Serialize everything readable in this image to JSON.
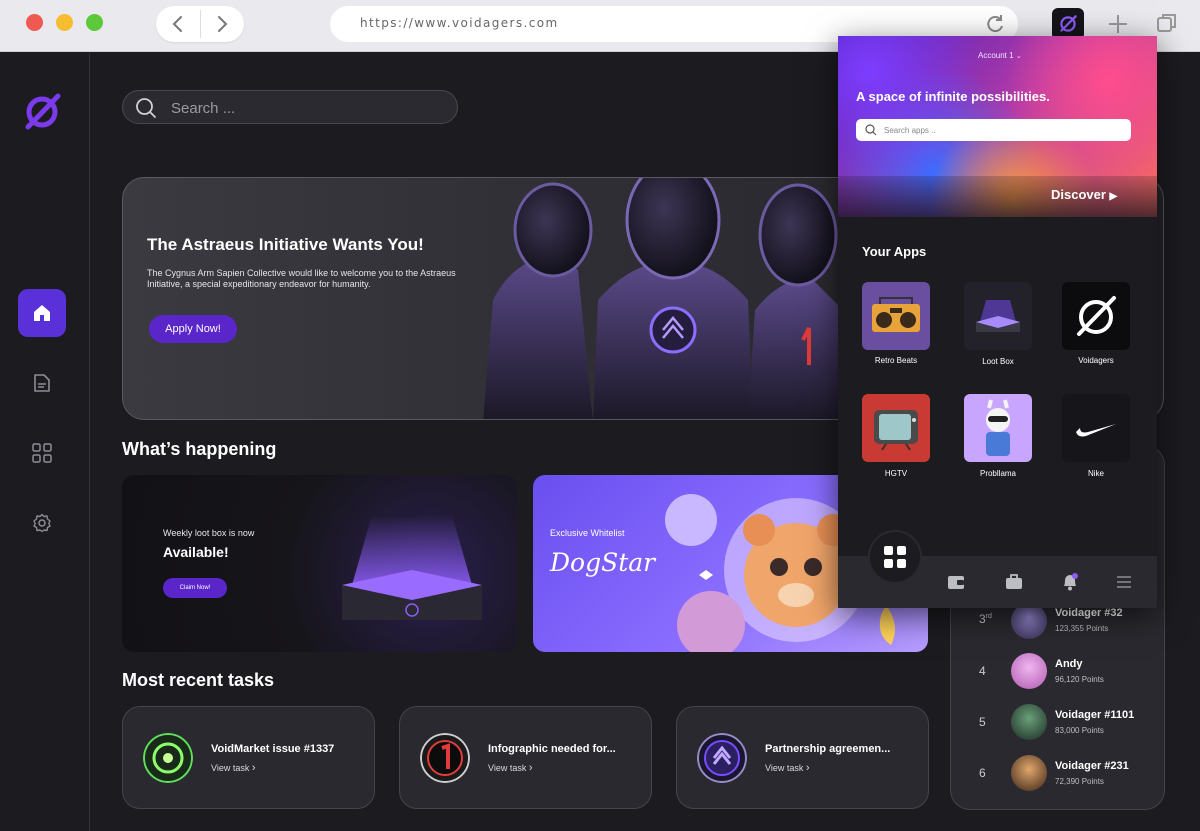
{
  "browser": {
    "url": "https://www.voidagers.com"
  },
  "search": {
    "placeholder": "Search ..."
  },
  "hero": {
    "title": "The Astraeus Initiative Wants You!",
    "description": "The Cygnus Arm Sapien Collective would like to welcome you to the Astraeus Initiative, a special expeditionary endeavor for humanity.",
    "cta": "Apply Now!"
  },
  "happening": {
    "heading": "What’s happening",
    "loot": {
      "small": "Weekly loot box is now",
      "big": "Available!",
      "cta": "Claim Now!"
    },
    "whitelist": {
      "small": "Exclusive Whitelist",
      "big": "DogStar"
    }
  },
  "tasks": {
    "heading": "Most recent tasks",
    "items": [
      {
        "title": "VoidMarket issue #1337",
        "link": "View task",
        "color": "#5fe05a"
      },
      {
        "title": "Infographic needed for...",
        "link": "View task",
        "color": "#e23b3b"
      },
      {
        "title": "Partnership agreemen...",
        "link": "View task",
        "color": "#7a4cff"
      }
    ]
  },
  "leaderboard": {
    "rows": [
      {
        "rank": "3",
        "suffix": "rd",
        "name": "Voidager #32",
        "points": "123,355 Points",
        "color": "#6d5aa8"
      },
      {
        "rank": "4",
        "suffix": "",
        "name": "Andy",
        "points": "96,120 Points",
        "color": "#d67ad6"
      },
      {
        "rank": "5",
        "suffix": "",
        "name": "Voidager #1101",
        "points": "83,000 Points",
        "color": "#3f6a4f"
      },
      {
        "rank": "6",
        "suffix": "",
        "name": "Voidager #231",
        "points": "72,390 Points",
        "color": "#b57a3f"
      }
    ]
  },
  "popup": {
    "account": "Account 1",
    "tagline": "A space of infinite possibilities.",
    "search_placeholder": "Search apps ..",
    "discover": "Discover",
    "your_apps": "Your Apps",
    "apps": [
      {
        "name": "Retro Beats",
        "bg": "#6a4fa0"
      },
      {
        "name": "Loot Box",
        "bg": "#23222a"
      },
      {
        "name": "Voidagers",
        "bg": "#0c0c0f"
      },
      {
        "name": "HGTV",
        "bg": "#c93a34"
      },
      {
        "name": "Probllama",
        "bg": "#c8a6ff"
      },
      {
        "name": "Nike",
        "bg": "#16161a"
      }
    ]
  },
  "colors": {
    "accent": "#5a26c9",
    "bg": "#1c1b20",
    "card": "#2a292f"
  }
}
